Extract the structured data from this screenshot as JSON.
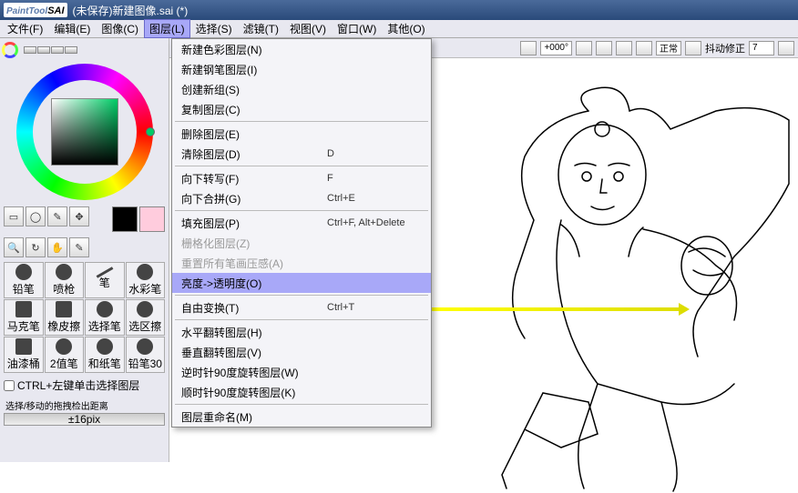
{
  "title": "(未保存)新建图像.sai (*)",
  "logo": {
    "paint": "PaintTool",
    "sai": "SAI"
  },
  "menu": {
    "file": "文件(F)",
    "edit": "编辑(E)",
    "image": "图像(C)",
    "layer": "图层(L)",
    "select": "选择(S)",
    "filter": "滤镜(T)",
    "view": "视图(V)",
    "window": "窗口(W)",
    "other": "其他(O)"
  },
  "dropdown": [
    {
      "label": "新建色彩图层(N)",
      "sc": ""
    },
    {
      "label": "新建钢笔图层(I)",
      "sc": ""
    },
    {
      "label": "创建新组(S)",
      "sc": ""
    },
    {
      "label": "复制图层(C)",
      "sc": ""
    },
    {
      "sep": true
    },
    {
      "label": "删除图层(E)",
      "sc": ""
    },
    {
      "label": "清除图层(D)",
      "sc": "D"
    },
    {
      "sep": true
    },
    {
      "label": "向下转写(F)",
      "sc": "F"
    },
    {
      "label": "向下合拼(G)",
      "sc": "Ctrl+E"
    },
    {
      "sep": true
    },
    {
      "label": "填充图层(P)",
      "sc": "Ctrl+F, Alt+Delete"
    },
    {
      "label": "栅格化图层(Z)",
      "sc": "",
      "disabled": true
    },
    {
      "label": "重置所有笔画压感(A)",
      "sc": "",
      "disabled": true
    },
    {
      "label": "亮度->透明度(O)",
      "sc": "",
      "hl": true
    },
    {
      "sep": true
    },
    {
      "label": "自由变换(T)",
      "sc": "Ctrl+T"
    },
    {
      "sep": true
    },
    {
      "label": "水平翻转图层(H)",
      "sc": ""
    },
    {
      "label": "垂直翻转图层(V)",
      "sc": ""
    },
    {
      "label": "逆时针90度旋转图层(W)",
      "sc": ""
    },
    {
      "label": "顺时针90度旋转图层(K)",
      "sc": ""
    },
    {
      "sep": true
    },
    {
      "label": "图层重命名(M)",
      "sc": ""
    }
  ],
  "canvasTb": {
    "angle": "+000°",
    "mode": "正常",
    "stab": "抖动修正",
    "stabVal": "7"
  },
  "brushes": [
    "铅笔",
    "喷枪",
    "笔",
    "水彩笔",
    "马克笔",
    "橡皮擦",
    "选择笔",
    "选区擦",
    "油漆桶",
    "2值笔",
    "和纸笔",
    "铅笔30"
  ],
  "chk": "CTRL+左键单击选择图层",
  "sliderLabel": "选择/移动的拖拽检出距离",
  "sliderVal": "±16pix"
}
